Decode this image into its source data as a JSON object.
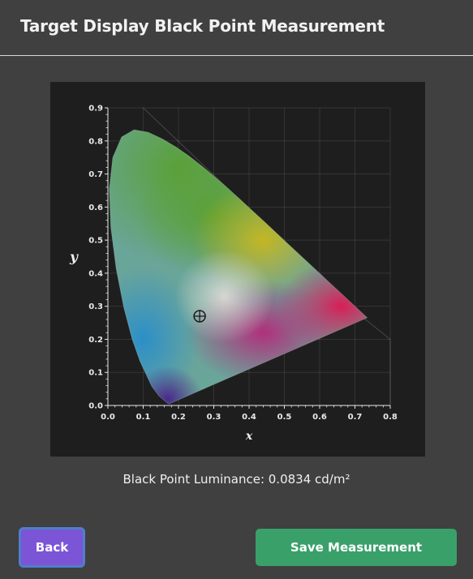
{
  "header": {
    "title": "Target Display Black Point Measurement"
  },
  "chart_data": {
    "type": "scatter",
    "title": "",
    "xlabel": "x",
    "ylabel": "y",
    "xlim": [
      0.0,
      0.8
    ],
    "ylim": [
      0.0,
      0.9
    ],
    "xticks": [
      "0.0",
      "0.1",
      "0.2",
      "0.3",
      "0.4",
      "0.5",
      "0.6",
      "0.7",
      "0.8"
    ],
    "yticks": [
      "0.0",
      "0.1",
      "0.2",
      "0.3",
      "0.4",
      "0.5",
      "0.6",
      "0.7",
      "0.8",
      "0.9"
    ],
    "grid": true,
    "series": [
      {
        "x": [
          0.26
        ],
        "y": [
          0.27
        ]
      }
    ]
  },
  "measurement": {
    "luminance_text": "Black Point Luminance: 0.0834 cd/m²"
  },
  "footer": {
    "back_label": "Back",
    "save_label": "Save Measurement"
  },
  "colors": {
    "background": "#404040",
    "back_button": "#7b55d6",
    "save_button": "#3aa06a"
  }
}
